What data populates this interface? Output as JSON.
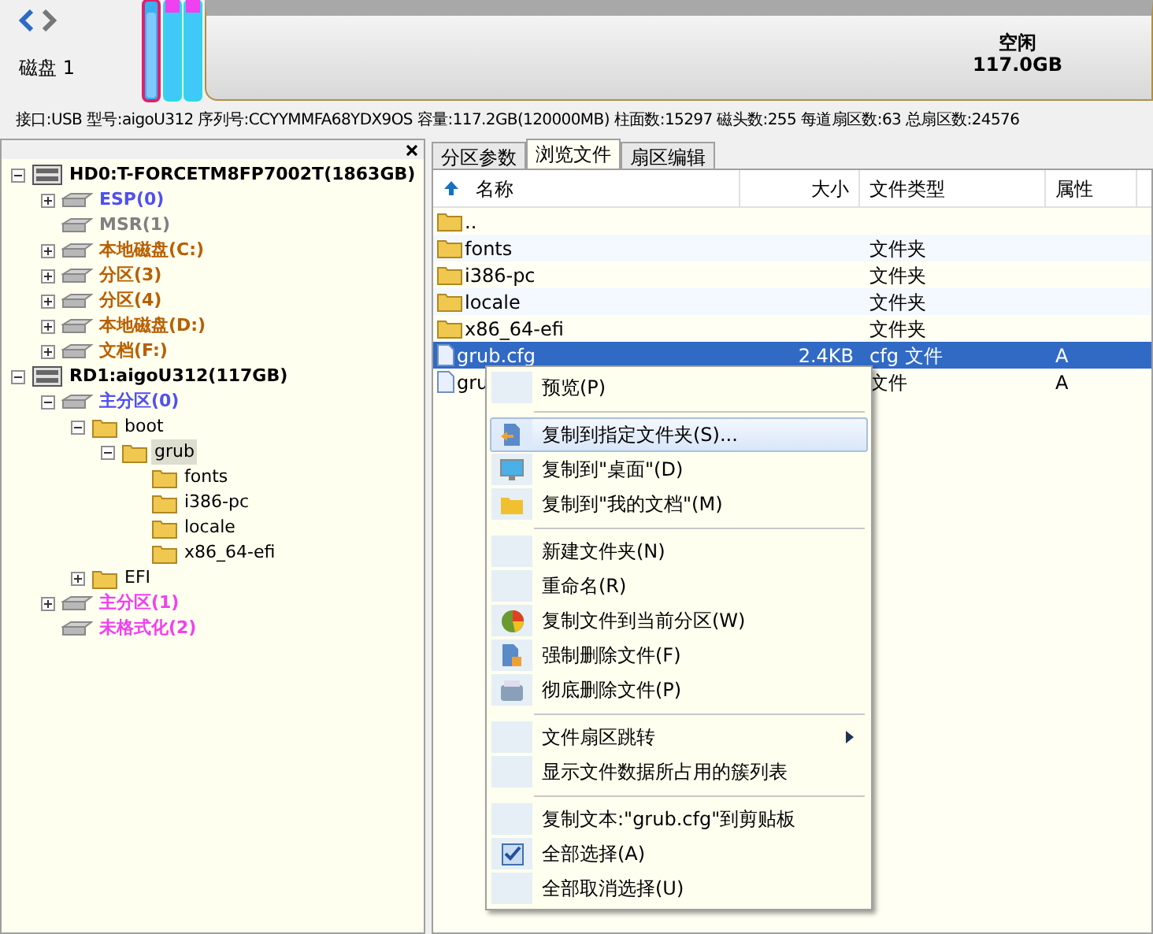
{
  "disk_map": {
    "label": "磁盘 1",
    "free_label": "空闲",
    "free_size": "117.0GB"
  },
  "disk_info": "接口:USB  型号:aigoU312  序列号:CCYYMMFA68YDX9OS  容量:117.2GB(120000MB)  柱面数:15297  磁头数:255  每道扇区数:63  总扇区数:24576",
  "tree": [
    {
      "kind": "disk",
      "label": "HD0:T-FORCETM8FP7002T(1863GB)",
      "expanded": true,
      "selected": false,
      "children": [
        {
          "kind": "partition",
          "label": "ESP(0)",
          "color": "#5050f0",
          "expanded": false,
          "selected": false
        },
        {
          "kind": "partition",
          "label": "MSR(1)",
          "color": "#808080",
          "selected": false
        },
        {
          "kind": "partition",
          "label": "本地磁盘(C:)",
          "color": "#b86000",
          "expanded": false,
          "selected": false
        },
        {
          "kind": "partition",
          "label": "分区(3)",
          "color": "#b86000",
          "expanded": false,
          "selected": false
        },
        {
          "kind": "partition",
          "label": "分区(4)",
          "color": "#b86000",
          "expanded": false,
          "selected": false
        },
        {
          "kind": "partition",
          "label": "本地磁盘(D:)",
          "color": "#b86000",
          "expanded": false,
          "selected": false
        },
        {
          "kind": "partition",
          "label": "文档(F:)",
          "color": "#b86000",
          "expanded": false,
          "selected": false
        }
      ]
    },
    {
      "kind": "disk",
      "label": "RD1:aigoU312(117GB)",
      "expanded": true,
      "selected": false,
      "children": [
        {
          "kind": "partition",
          "label": "主分区(0)",
          "color": "#5050f0",
          "expanded": true,
          "selected": false,
          "children": [
            {
              "kind": "folder",
              "label": "boot",
              "expanded": true,
              "selected": false,
              "children": [
                {
                  "kind": "folder",
                  "label": "grub",
                  "expanded": true,
                  "selected": true,
                  "children": [
                    {
                      "kind": "folder",
                      "label": "fonts",
                      "selected": false
                    },
                    {
                      "kind": "folder",
                      "label": "i386-pc",
                      "selected": false
                    },
                    {
                      "kind": "folder",
                      "label": "locale",
                      "selected": false
                    },
                    {
                      "kind": "folder",
                      "label": "x86_64-efi",
                      "selected": false
                    }
                  ]
                }
              ]
            },
            {
              "kind": "folder",
              "label": "EFI",
              "expanded": false,
              "selected": false
            }
          ]
        },
        {
          "kind": "partition",
          "label": "主分区(1)",
          "color": "#f040f0",
          "expanded": false,
          "selected": false
        },
        {
          "kind": "partition",
          "label": "未格式化(2)",
          "color": "#f040f0",
          "selected": false
        }
      ]
    }
  ],
  "tabs": [
    {
      "label": "分区参数",
      "selected": false
    },
    {
      "label": "浏览文件",
      "selected": true
    },
    {
      "label": "扇区编辑",
      "selected": false
    }
  ],
  "columns": [
    "名称",
    "大小",
    "文件类型",
    "属性"
  ],
  "files": [
    {
      "kind": "folder",
      "name": "..",
      "selected": false
    },
    {
      "kind": "folder",
      "name": "fonts",
      "type": "文件夹",
      "selected": false
    },
    {
      "kind": "folder",
      "name": "i386-pc",
      "type": "文件夹",
      "selected": false
    },
    {
      "kind": "folder",
      "name": "locale",
      "type": "文件夹",
      "selected": false
    },
    {
      "kind": "folder",
      "name": "x86_64-efi",
      "type": "文件夹",
      "selected": false
    },
    {
      "kind": "file",
      "name": "grub.cfg",
      "size": "2.4KB",
      "type": "cfg 文件",
      "attr": "A",
      "selected": true
    },
    {
      "kind": "file",
      "name": "gru",
      "type": "文件",
      "attr": "A",
      "selected": false
    }
  ],
  "context_menu": [
    {
      "kind": "item",
      "label": "预览(P)"
    },
    {
      "kind": "separator"
    },
    {
      "kind": "item",
      "label": "复制到指定文件夹(S)...",
      "selected": true
    },
    {
      "kind": "item",
      "label": "复制到\"桌面\"(D)"
    },
    {
      "kind": "item",
      "label": "复制到\"我的文档\"(M)"
    },
    {
      "kind": "separator"
    },
    {
      "kind": "item",
      "label": "新建文件夹(N)"
    },
    {
      "kind": "item",
      "label": "重命名(R)"
    },
    {
      "kind": "item",
      "label": "复制文件到当前分区(W)"
    },
    {
      "kind": "item",
      "label": "强制删除文件(F)"
    },
    {
      "kind": "item",
      "label": "彻底删除文件(P)"
    },
    {
      "kind": "separator"
    },
    {
      "kind": "item",
      "label": "文件扇区跳转",
      "submenu": true
    },
    {
      "kind": "item",
      "label": "显示文件数据所占用的簇列表"
    },
    {
      "kind": "separator"
    },
    {
      "kind": "item",
      "label": "复制文本:\"grub.cfg\"到剪贴板"
    },
    {
      "kind": "item",
      "label": "全部选择(A)"
    },
    {
      "kind": "item",
      "label": "全部取消选择(U)"
    }
  ]
}
